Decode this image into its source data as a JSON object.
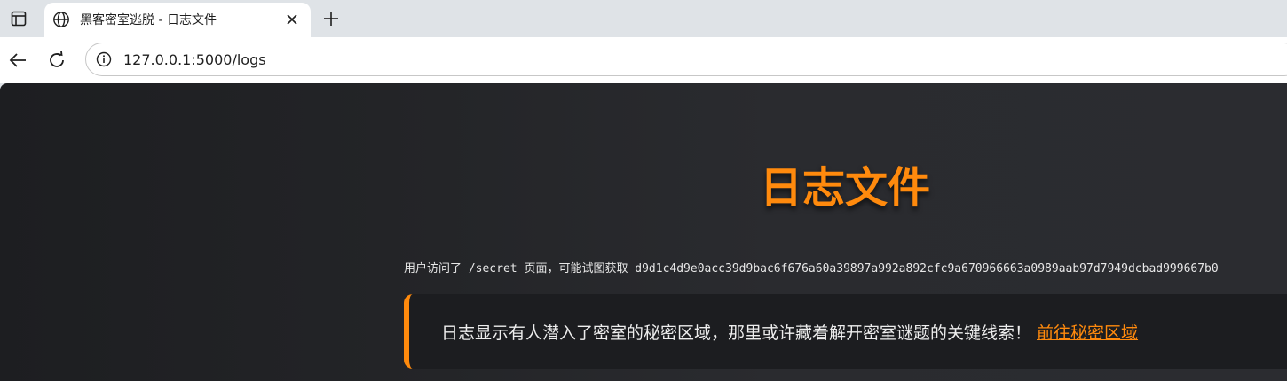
{
  "browser": {
    "tab": {
      "title": "黑客密室逃脱 - 日志文件",
      "favicon": "globe-icon"
    },
    "url": "127.0.0.1:5000/logs"
  },
  "page": {
    "title": "日志文件",
    "log_entry": "用户访问了 /secret 页面，可能试图获取 d9d1c4d9e0acc39d9bac6f676a60a39897a992a892cfc9a670966663a0989aab97d7949dcbad999667b0",
    "hint": {
      "text": "日志显示有人潜入了密室的秘密区域，那里或许藏着解开密室谜题的关键线索！",
      "link_label": "前往秘密区域"
    }
  },
  "colors": {
    "accent": "#ff8a0d",
    "background": "#232427",
    "text": "#e8e8e8"
  }
}
